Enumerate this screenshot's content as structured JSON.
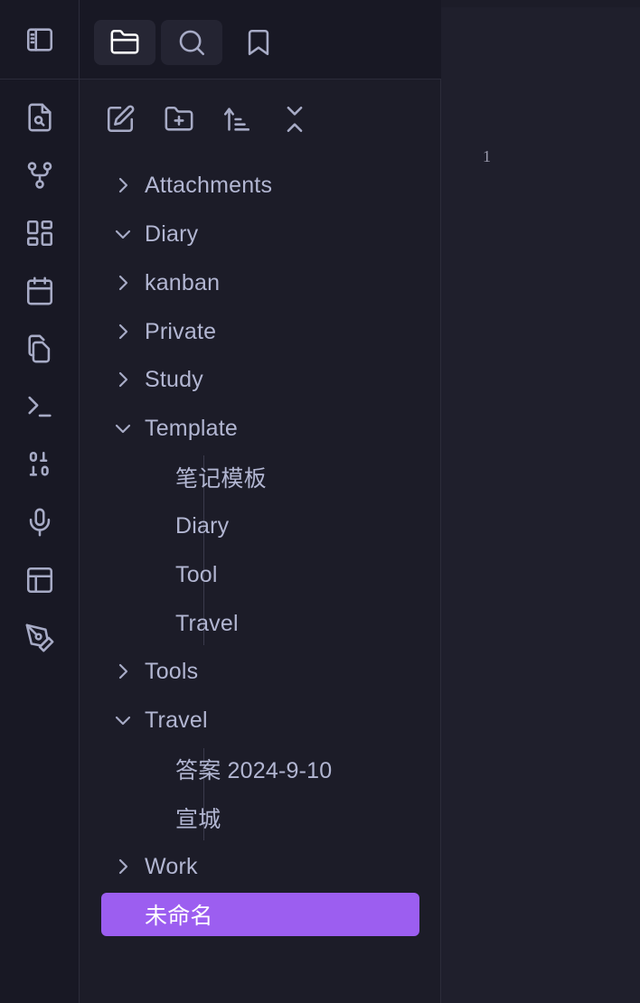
{
  "ribbon": {
    "toggle_sidebar": "sidebar-toggle-icon",
    "actions": [
      {
        "name": "quick-switcher-icon",
        "icon": "file-search"
      },
      {
        "name": "graph-view-icon",
        "icon": "git-fork"
      },
      {
        "name": "canvas-icon",
        "icon": "layout-dashboard"
      },
      {
        "name": "daily-notes-icon",
        "icon": "calendar"
      },
      {
        "name": "templates-icon",
        "icon": "copy"
      },
      {
        "name": "command-palette-icon",
        "icon": "terminal"
      },
      {
        "name": "binary-icon",
        "icon": "binary"
      },
      {
        "name": "audio-recorder-icon",
        "icon": "mic"
      },
      {
        "name": "workspace-layout-icon",
        "icon": "layout"
      },
      {
        "name": "excalidraw-icon",
        "icon": "pen-tool"
      }
    ]
  },
  "tabs": [
    {
      "name": "files-tab",
      "icon": "folder-icon",
      "active": true
    },
    {
      "name": "search-tab",
      "icon": "search-icon",
      "active": false
    },
    {
      "name": "bookmarks-tab",
      "icon": "bookmark-icon",
      "active": false
    }
  ],
  "nav_actions": [
    {
      "name": "new-note-button",
      "icon": "edit-icon"
    },
    {
      "name": "new-folder-button",
      "icon": "folder-plus-icon"
    },
    {
      "name": "sort-button",
      "icon": "sort-icon"
    },
    {
      "name": "collapse-all-button",
      "icon": "collapse-icon"
    }
  ],
  "tree": [
    {
      "label": "Attachments",
      "type": "folder",
      "expanded": false
    },
    {
      "label": "Diary",
      "type": "folder",
      "expanded": true
    },
    {
      "label": "kanban",
      "type": "folder",
      "expanded": false
    },
    {
      "label": "Private",
      "type": "folder",
      "expanded": false
    },
    {
      "label": "Study",
      "type": "folder",
      "expanded": false
    },
    {
      "label": "Template",
      "type": "folder",
      "expanded": true
    },
    {
      "label": "笔记模板",
      "type": "file"
    },
    {
      "label": "Diary",
      "type": "file"
    },
    {
      "label": "Tool",
      "type": "file"
    },
    {
      "label": "Travel",
      "type": "file"
    },
    {
      "label": "Tools",
      "type": "folder",
      "expanded": false
    },
    {
      "label": "Travel",
      "type": "folder",
      "expanded": true
    },
    {
      "label": "答案 2024-9-10",
      "type": "file"
    },
    {
      "label": "宣城",
      "type": "file"
    },
    {
      "label": "Work",
      "type": "folder",
      "expanded": false
    },
    {
      "label": "未命名",
      "type": "file",
      "selected": true
    }
  ],
  "editor": {
    "line_number": "1"
  },
  "colors": {
    "accent": "#9c5ef0",
    "text": "#b2b6d2",
    "icon": "#a7abc6",
    "background": "#1c1c28"
  }
}
